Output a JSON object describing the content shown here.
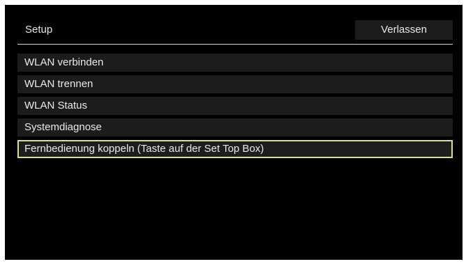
{
  "header": {
    "title": "Setup",
    "exit_label": "Verlassen"
  },
  "menu": {
    "items": [
      {
        "label": "WLAN verbinden",
        "selected": false
      },
      {
        "label": "WLAN trennen",
        "selected": false
      },
      {
        "label": "WLAN Status",
        "selected": false
      },
      {
        "label": "Systemdiagnose",
        "selected": false
      },
      {
        "label": "Fernbedienung koppeln (Taste auf der Set Top Box)",
        "selected": true
      }
    ]
  },
  "colors": {
    "background": "#000000",
    "item_background": "#1c1c1c",
    "text": "#eaeaea",
    "selection_border": "#dde08a",
    "divider": "#d8d8d8"
  }
}
